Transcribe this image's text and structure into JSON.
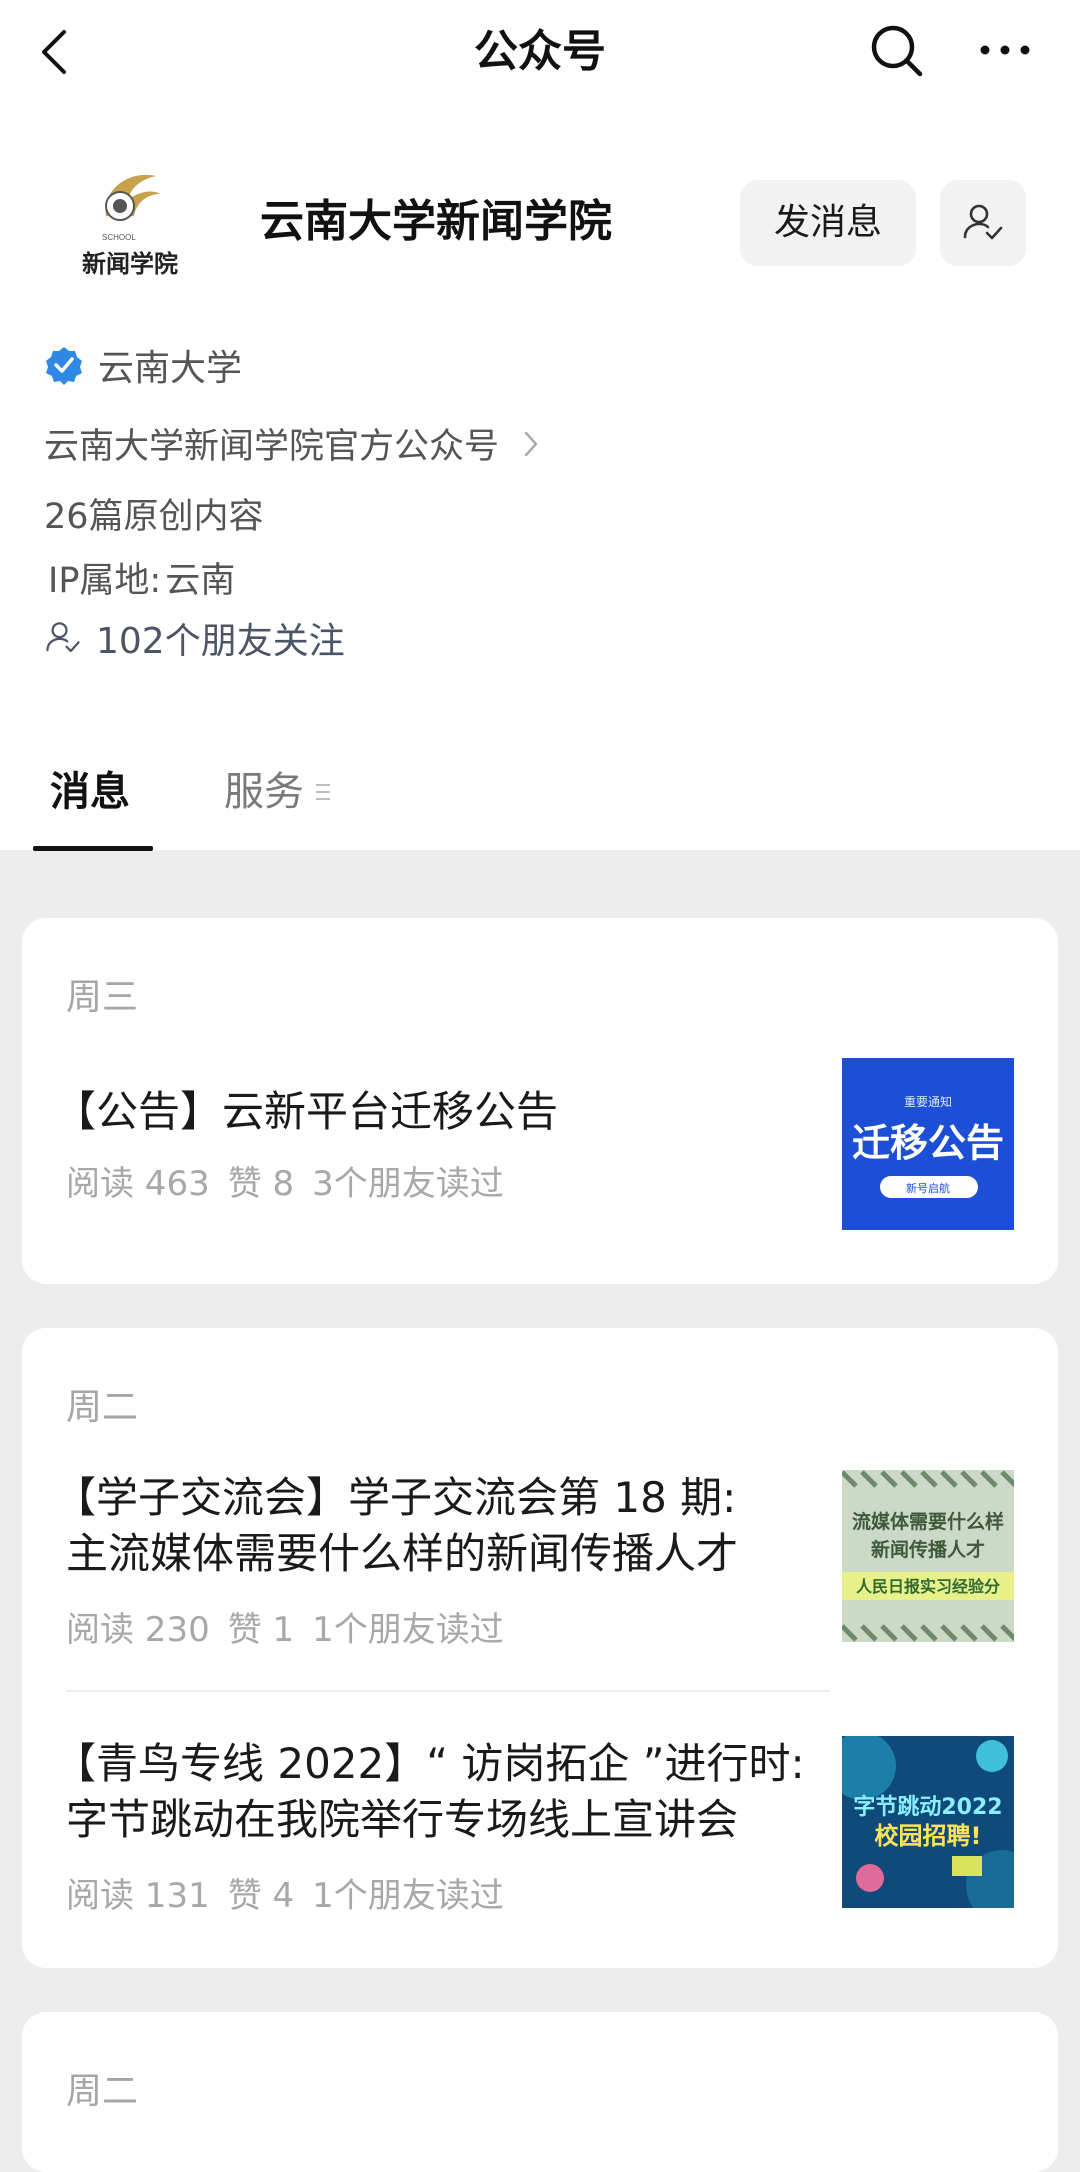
{
  "header": {
    "title": "公众号"
  },
  "profile": {
    "name": "云南大学新闻学院",
    "logo_text": "新闻学院",
    "logo_small_text": "SCHOOL",
    "send_message_label": "发消息",
    "verified_org": "云南大学",
    "description": "云南大学新闻学院官方公众号",
    "original_count": "26篇原创内容",
    "ip_label": "IP属地:",
    "ip_value": "云南",
    "friends_following": "102个朋友关注"
  },
  "tabs": [
    {
      "label": "消息",
      "active": true
    },
    {
      "label": "服务",
      "active": false
    }
  ],
  "feed": [
    {
      "day": "周三",
      "articles": [
        {
          "title": "【公告】云新平台迁移公告",
          "reads": "阅读 463",
          "likes": "赞 8",
          "friends_read": "3个朋友读过",
          "thumb_top_text": "重要通知",
          "thumb_main_text": "迁移公告",
          "thumb_sub_text": "新号启航"
        }
      ]
    },
    {
      "day": "周二",
      "articles": [
        {
          "title": "【学子交流会】学子交流会第 18 期:",
          "title_line2": "主流媒体需要什么样的新闻传播人才",
          "reads": "阅读 230",
          "likes": "赞 1",
          "friends_read": "1个朋友读过",
          "thumb_line1": "流媒体需要什么样",
          "thumb_line2": "新闻传播人才",
          "thumb_line3": "人民日报实习经验分"
        },
        {
          "title": "【青鸟专线 2022】“ 访岗拓企 ”进行时:",
          "title_line2": "字节跳动在我院举行专场线上宣讲会",
          "reads": "阅读 131",
          "likes": "赞 4",
          "friends_read": "1个朋友读过",
          "thumb_line1": "字节跳动2022",
          "thumb_line2": "校园招聘!"
        }
      ]
    },
    {
      "day": "周二"
    }
  ],
  "colors": {
    "verified_blue": "#2f87e6",
    "page_bg": "#ededed",
    "thumb1_blue": "#1c4fd6"
  }
}
